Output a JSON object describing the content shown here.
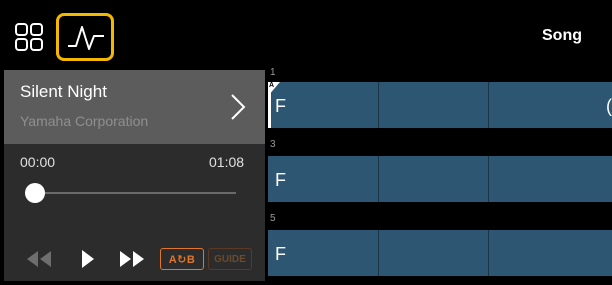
{
  "topbar": {
    "song_label": "Song",
    "grid_icon": "grid-icon",
    "waveform_icon": "waveform-icon",
    "accent_color": "#f5b800"
  },
  "song": {
    "title": "Silent Night",
    "artist": "Yamaha Corporation",
    "chevron_icon": "chevron-right-icon"
  },
  "playback": {
    "time_start": "00:00",
    "time_end": "01:08",
    "progress": 0
  },
  "transport": {
    "rewind_icon": "rewind-icon",
    "play_icon": "play-icon",
    "fast_forward_icon": "fast-forward-icon",
    "ab_label": "A↻B",
    "guide_label": "GUIDE"
  },
  "chords": {
    "rows": [
      {
        "bar": "1",
        "marker": "A",
        "first_chord": "F",
        "edge_char": "("
      },
      {
        "bar": "3",
        "first_chord": "F"
      },
      {
        "bar": "5",
        "first_chord": "F"
      }
    ]
  },
  "colors": {
    "chord_row": "#2d5672",
    "ab_active": "#e0762a"
  }
}
